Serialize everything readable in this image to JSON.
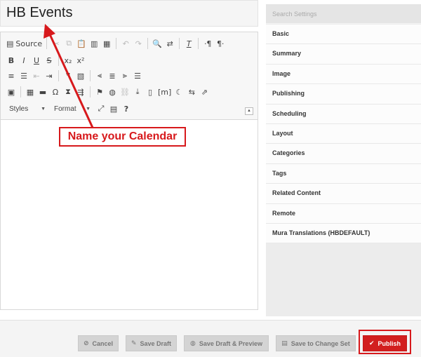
{
  "title_field": {
    "value": "HB Events"
  },
  "toolbar": {
    "source_label": "Source",
    "styles_label": "Styles",
    "format_label": "Format"
  },
  "settings": {
    "search_placeholder": "Search Settings",
    "items": [
      {
        "label": "Basic"
      },
      {
        "label": "Summary"
      },
      {
        "label": "Image"
      },
      {
        "label": "Publishing"
      },
      {
        "label": "Scheduling"
      },
      {
        "label": "Layout"
      },
      {
        "label": "Categories"
      },
      {
        "label": "Tags"
      },
      {
        "label": "Related Content"
      },
      {
        "label": "Remote"
      },
      {
        "label": "Mura Translations (HBDEFAULT)"
      }
    ]
  },
  "actions": {
    "cancel": "Cancel",
    "save_draft": "Save Draft",
    "save_draft_preview": "Save Draft & Preview",
    "save_change_set": "Save to Change Set",
    "publish": "Publish"
  },
  "annotation": {
    "callout": "Name your Calendar"
  },
  "colors": {
    "annotation": "#d7191c",
    "publish": "#d21f1f",
    "panel": "#ececec"
  }
}
